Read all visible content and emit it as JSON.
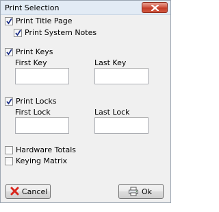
{
  "window": {
    "title": "Print Selection",
    "close_icon": "close-icon"
  },
  "options": {
    "print_title_page": {
      "label": "Print Title Page",
      "checked": true
    },
    "print_system_notes": {
      "label": "Print System Notes",
      "checked": true
    },
    "print_keys": {
      "label": "Print Keys",
      "checked": true
    },
    "print_locks": {
      "label": "Print Locks",
      "checked": true
    },
    "hardware_totals": {
      "label": "Hardware Totals",
      "checked": false
    },
    "keying_matrix": {
      "label": "Keying Matrix",
      "checked": false
    }
  },
  "keys": {
    "first_label": "First Key",
    "first_value": "",
    "last_label": "Last Key",
    "last_value": ""
  },
  "locks": {
    "first_label": "First Lock",
    "first_value": "",
    "last_label": "Last Lock",
    "last_value": ""
  },
  "buttons": {
    "cancel_label": "Cancel",
    "cancel_icon": "red-x-icon",
    "ok_label": "Ok",
    "ok_icon": "printer-icon"
  },
  "colors": {
    "close_button": "#c94a35",
    "cancel_icon": "#d9261c"
  }
}
